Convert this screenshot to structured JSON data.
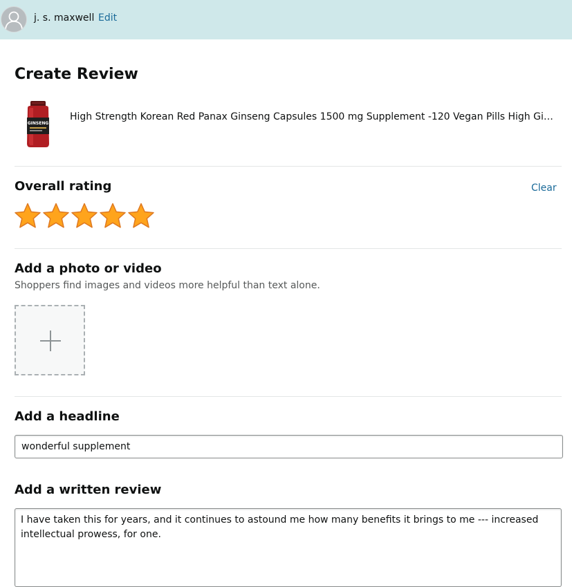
{
  "header": {
    "username": "j. s. maxwell",
    "edit_label": "Edit"
  },
  "page_title": "Create Review",
  "product": {
    "title": "High Strength Korean Red Panax Ginseng Capsules 1500 mg Supplement -120 Vegan Pills High Ginseng Extract",
    "label_text": "GINSENG"
  },
  "rating": {
    "heading": "Overall rating",
    "clear_label": "Clear",
    "value": 5,
    "max": 5,
    "star_color": "#ffa41c"
  },
  "media": {
    "heading": "Add a photo or video",
    "subtext": "Shoppers find images and videos more helpful than text alone."
  },
  "headline": {
    "heading": "Add a headline",
    "value": "wonderful supplement"
  },
  "written_review": {
    "heading": "Add a written review",
    "value": "I have taken this for years, and it continues to astound me how many benefits it brings to me --- increased intellectual prowess, for one."
  },
  "colors": {
    "header_bg": "#cfe8ea",
    "link": "#1a6a99",
    "text": "#0f1111",
    "muted": "#565959"
  }
}
